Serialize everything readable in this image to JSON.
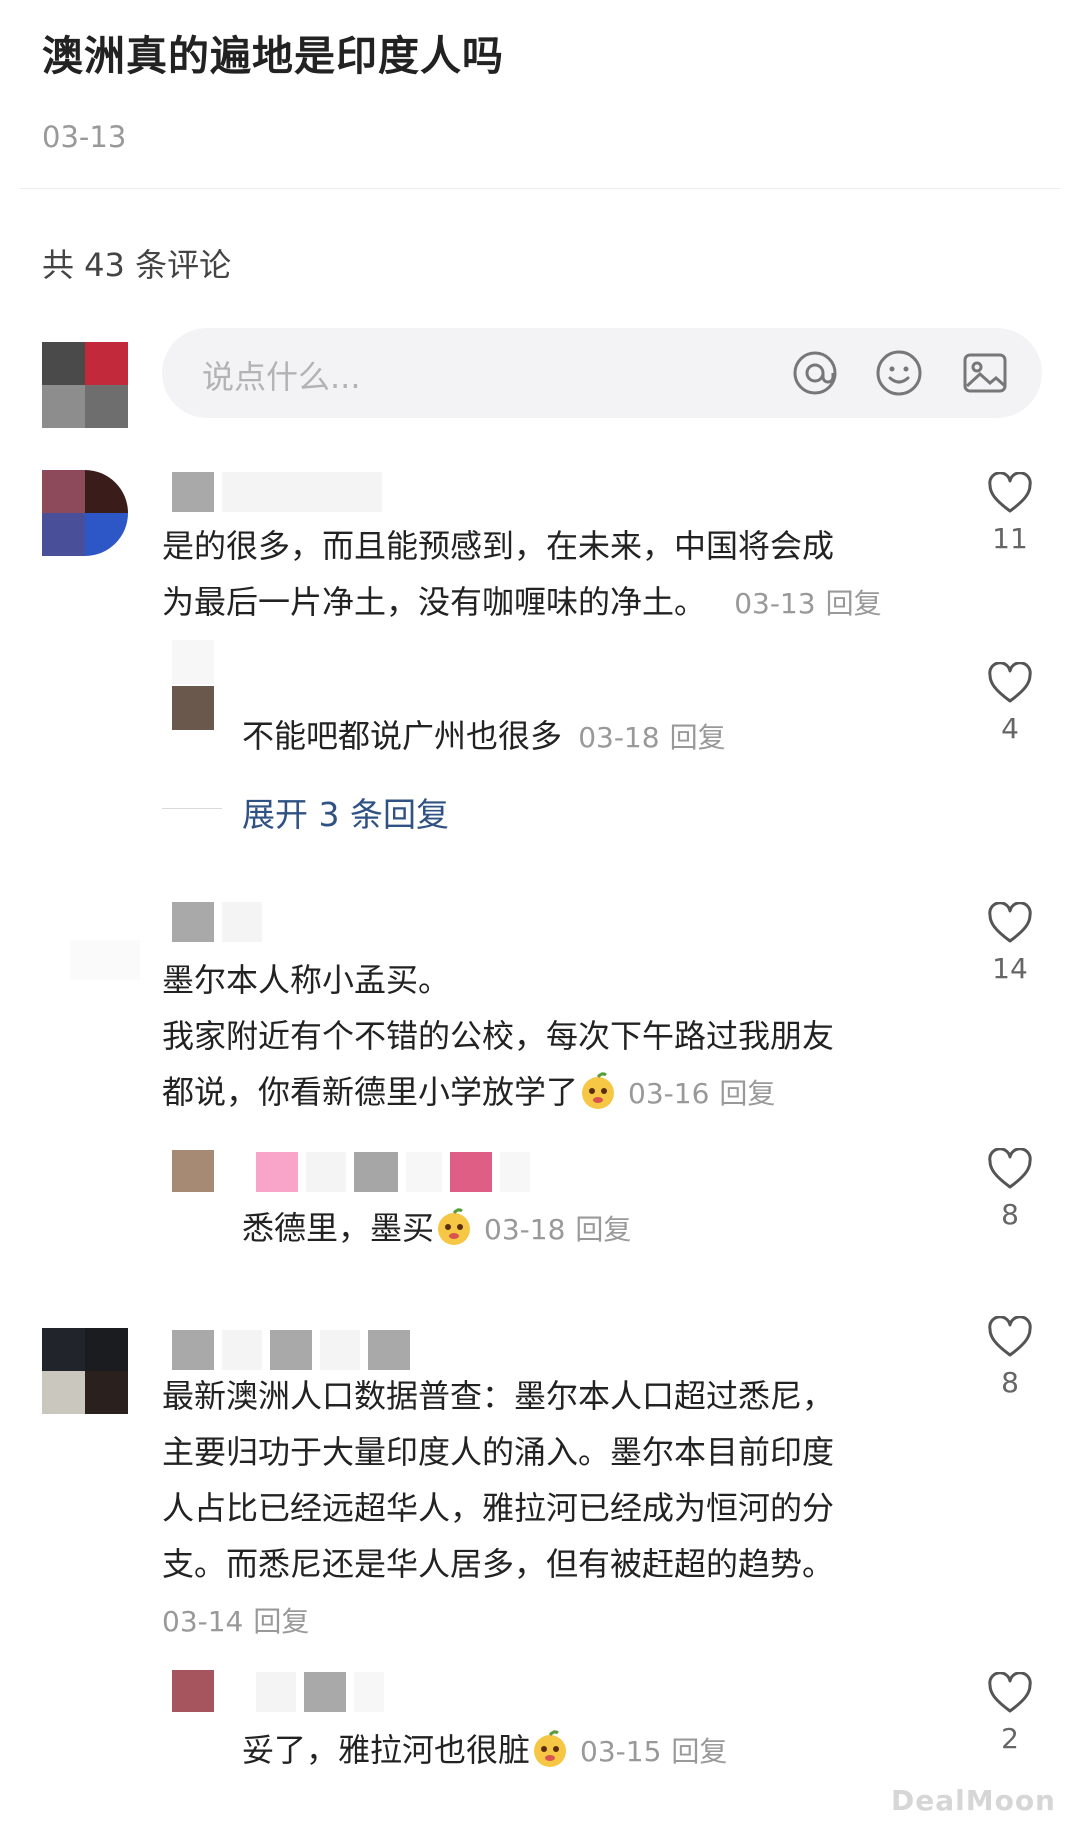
{
  "post": {
    "title": "澳洲真的遍地是印度人吗",
    "date": "03-13"
  },
  "comments_header": {
    "count_text": "共 43 条评论"
  },
  "input": {
    "placeholder": "说点什么...",
    "icons": [
      "at-icon",
      "emoji-icon",
      "image-icon"
    ]
  },
  "comments": [
    {
      "text_lines": [
        "是的很多，而且能预感到，在未来，中国将会成",
        "为最后一片净土，没有咖喱味的净土。"
      ],
      "date": "03-13",
      "reply_label": "回复",
      "likes": "11",
      "replies": [
        {
          "text": "不能吧都说广州也很多",
          "date": "03-18",
          "reply_label": "回复",
          "likes": "4"
        }
      ],
      "expand_label": "展开 3 条回复"
    },
    {
      "text_lines": [
        "墨尔本人称小孟买。",
        "我家附近有个不错的公校，每次下午路过我朋友",
        "都说，你看新德里小学放学了"
      ],
      "date": "03-16",
      "reply_label": "回复",
      "likes": "14",
      "replies": [
        {
          "text": "悉德里，墨买",
          "date": "03-18",
          "reply_label": "回复",
          "likes": "8"
        }
      ]
    },
    {
      "text_lines": [
        "最新澳洲人口数据普查：墨尔本人口超过悉尼，",
        "主要归功于大量印度人的涌入。墨尔本目前印度",
        "人占比已经远超华人，雅拉河已经成为恒河的分",
        "支。而悉尼还是华人居多，但有被赶超的趋势。"
      ],
      "date": "03-14",
      "reply_label": "回复",
      "likes": "8",
      "replies": [
        {
          "text": "妥了，雅拉河也很脏",
          "date": "03-15",
          "reply_label": "回复",
          "likes": "2"
        }
      ]
    }
  ],
  "watermark": "DealMoon",
  "colors": {
    "link": "#2f5183",
    "meta": "#999999",
    "heart": "#555555"
  }
}
